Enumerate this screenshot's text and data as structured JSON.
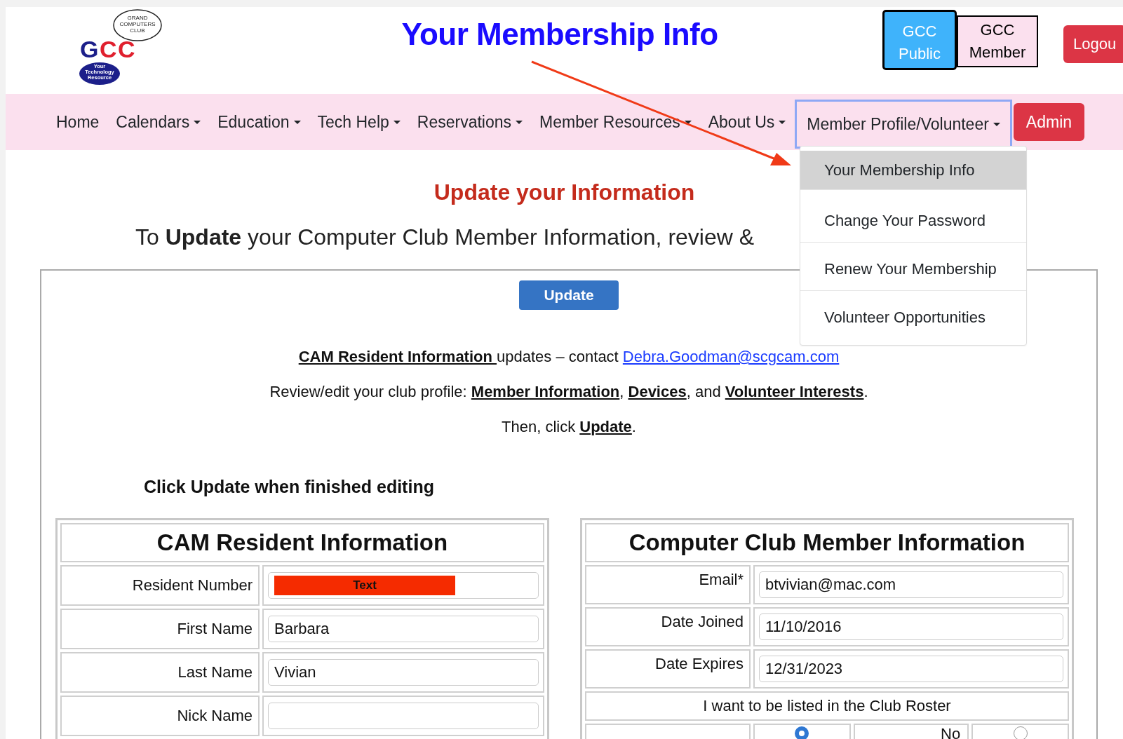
{
  "header": {
    "logo": {
      "letters": "GCC",
      "club_lines": [
        "GRAND",
        "COMPUTERS",
        "CLUB"
      ],
      "badge_lines": [
        "Your",
        "Technology",
        "Resource"
      ]
    },
    "title": "Your Membership Info",
    "site_buttons": [
      {
        "label_lines": [
          "GCC",
          "Public"
        ],
        "selected": true
      },
      {
        "label_lines": [
          "GCC",
          "Member"
        ],
        "selected": false
      }
    ],
    "logout": "Logou"
  },
  "nav": {
    "items": [
      {
        "label": "Home",
        "kind": "link",
        "expanded": false
      },
      {
        "label": "Calendars",
        "kind": "dropdown",
        "expanded": false
      },
      {
        "label": "Education",
        "kind": "dropdown",
        "expanded": false
      },
      {
        "label": "Tech Help",
        "kind": "dropdown",
        "expanded": false
      },
      {
        "label": "Reservations",
        "kind": "dropdown",
        "expanded": false
      },
      {
        "label": "Member Resources",
        "kind": "dropdown",
        "expanded": false
      },
      {
        "label": "About Us",
        "kind": "dropdown",
        "expanded": false
      },
      {
        "label": "Member Profile/Volunteer",
        "kind": "dropdown",
        "expanded": true
      },
      {
        "label": "Admin",
        "kind": "button",
        "expanded": false
      }
    ],
    "menu": [
      {
        "label": "Your Membership Info",
        "selected": true
      },
      {
        "label": "Change Your Password",
        "selected": false
      },
      {
        "label": "Renew Your Membership",
        "selected": false
      },
      {
        "label": "Volunteer Opportunities",
        "selected": false
      }
    ]
  },
  "content": {
    "heading": "Update your Information",
    "intro": "To **Update** your Computer Club Member Information, review &",
    "update_button": "Update",
    "lines": [
      [
        {
          "kind": "anchor",
          "text": "CAM Resident Information "
        },
        {
          "kind": "text",
          "text": "updates – contact "
        },
        {
          "kind": "email",
          "text": "Debra.Goodman@scgcam.com"
        }
      ],
      [
        {
          "kind": "text",
          "text": "Review/edit your club profile: "
        },
        {
          "kind": "anchor",
          "text": "Member Information"
        },
        {
          "kind": "text",
          "text": ", "
        },
        {
          "kind": "anchor",
          "text": "Devices"
        },
        {
          "kind": "text",
          "text": ", and "
        },
        {
          "kind": "anchor",
          "text": "Volunteer Interests"
        },
        {
          "kind": "text",
          "text": "."
        }
      ],
      [
        {
          "kind": "text",
          "text": "Then, click "
        },
        {
          "kind": "anchor",
          "text": "Update"
        },
        {
          "kind": "text",
          "text": "."
        }
      ]
    ],
    "finish_note": "Click Update when finished editing",
    "resident_table": {
      "title": "CAM Resident Information",
      "rows": [
        {
          "label": "Resident Number",
          "value": "Text",
          "redacted": true
        },
        {
          "label": "First Name",
          "value": "Barbara",
          "redacted": false
        },
        {
          "label": "Last Name",
          "value": "Vivian",
          "redacted": false
        },
        {
          "label": "Nick Name",
          "redacted": false
        }
      ]
    },
    "member_table": {
      "title": "Computer Club Member Information",
      "rows": [
        {
          "label": "Email*",
          "value": "btvivian@mac.com",
          "redacted": false
        },
        {
          "label": "Date Joined",
          "value": "11/10/2016",
          "redacted": false
        },
        {
          "label": "Date Expires",
          "value": "12/31/2023",
          "redacted": false
        }
      ],
      "roster": {
        "question": "I want to be listed in the Club Roster",
        "options": [
          {
            "selected": true
          },
          {
            "label": "No",
            "selected": false
          }
        ]
      }
    }
  }
}
